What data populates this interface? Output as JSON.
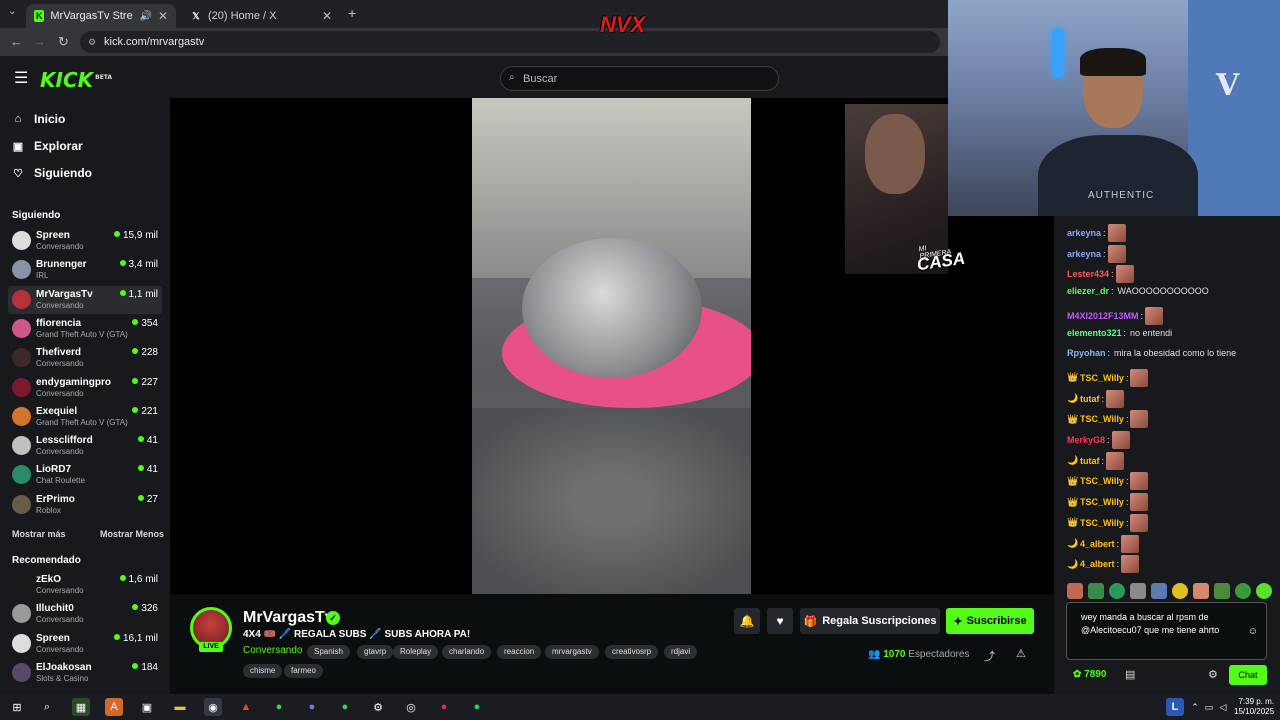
{
  "browser": {
    "tabs": [
      {
        "title": "MrVargasTv Stream - Watch",
        "active": true
      },
      {
        "title": "(20) Home / X",
        "active": false
      }
    ],
    "url": "kick.com/mrvargastv",
    "overlay_logo": "NVX"
  },
  "header": {
    "logo": "KICK",
    "logo_tag": "BETA",
    "search_placeholder": "Buscar"
  },
  "sidebar": {
    "nav": [
      {
        "label": "Inicio",
        "icon": "home-icon"
      },
      {
        "label": "Explorar",
        "icon": "compass-icon"
      },
      {
        "label": "Siguiendo",
        "icon": "heart-icon"
      }
    ],
    "following_title": "Siguiendo",
    "following": [
      {
        "name": "Spreen",
        "category": "Conversando",
        "viewers": "15,9 mil",
        "color": "#ddd"
      },
      {
        "name": "Brunenger",
        "category": "IRL",
        "viewers": "3,4 mil",
        "color": "#8a94a8"
      },
      {
        "name": "MrVargasTv",
        "category": "Conversando",
        "viewers": "1,1 mil",
        "color": "#b5323a",
        "selected": true
      },
      {
        "name": "ffiorencia",
        "category": "Grand Theft Auto V (GTA)",
        "viewers": "354",
        "color": "#d0578a"
      },
      {
        "name": "Thefiverd",
        "category": "Conversando",
        "viewers": "228",
        "color": "#3a2a2a"
      },
      {
        "name": "endygamingpro",
        "category": "Conversando",
        "viewers": "227",
        "color": "#7a1a2a"
      },
      {
        "name": "Exequiel",
        "category": "Grand Theft Auto V (GTA)",
        "viewers": "221",
        "color": "#d0762a"
      },
      {
        "name": "Lessclifford",
        "category": "Conversando",
        "viewers": "41",
        "color": "#c0c0c0"
      },
      {
        "name": "LioRD7",
        "category": "Chat Roulette",
        "viewers": "41",
        "color": "#2a8a6a"
      },
      {
        "name": "ErPrimo",
        "category": "Roblox",
        "viewers": "27",
        "color": "#6a5a4a"
      }
    ],
    "show_more": "Mostrar más",
    "show_less": "Mostrar Menos",
    "recommended_title": "Recomendado",
    "recommended": [
      {
        "name": "zEkO",
        "category": "Conversando",
        "viewers": "1,6 mil",
        "color": "#1a1a1a"
      },
      {
        "name": "Illuchit0",
        "category": "Conversando",
        "viewers": "326",
        "color": "#9a9a9a"
      },
      {
        "name": "Spreen",
        "category": "Conversando",
        "viewers": "16,1 mil",
        "color": "#ddd"
      },
      {
        "name": "ElJoakosan",
        "category": "Slots & Casino",
        "viewers": "184",
        "color": "#5a4a6a"
      }
    ]
  },
  "stream": {
    "overlay_text": "MI PRIMERA",
    "overlay_text2": "CASA",
    "channel": "MrVargasTv",
    "live": "LIVE",
    "title": "4X4 🎟️ 🖊️ REGALA SUBS 🖊️ SUBS AHORA PA!",
    "category": "Conversando",
    "tags": [
      "Spanish",
      "gtavrp",
      "Roleplay",
      "charlando",
      "reaccion",
      "mrvargastv",
      "creativosrp",
      "rdjavi",
      "chisme",
      "farmeo"
    ],
    "gift_label": "Regala Suscripciones",
    "subscribe_label": "Suscribirse",
    "viewers_count": "1070",
    "viewers_label": "Espectadores"
  },
  "chat": {
    "messages": [
      {
        "user": "arkeyna",
        "color": "#8aa8ff",
        "text": "",
        "emote": true,
        "badge": ""
      },
      {
        "user": "arkeyna",
        "color": "#8aa8ff",
        "text": "",
        "emote": true,
        "badge": ""
      },
      {
        "user": "Lester434",
        "color": "#ff5a5a",
        "text": "",
        "emote": true,
        "badge": ""
      },
      {
        "user": "eliezer_dr",
        "color": "#5aff5a",
        "text": "WAOOOOOOOOOOO",
        "emote": false,
        "badge": ""
      },
      {
        "user": "M4XI2012F13MM",
        "color": "#c05aff",
        "text": "",
        "emote": true,
        "badge": ""
      },
      {
        "user": "elemento321",
        "color": "#5aff8a",
        "text": "no entendi",
        "emote": false,
        "badge": ""
      },
      {
        "user": "Rpyohan",
        "color": "#8ab4ff",
        "text": "mira la obesidad como lo tiene",
        "emote": false,
        "badge": ""
      },
      {
        "user": "TSC_Willy",
        "color": "#ffc21a",
        "text": "",
        "emote": true,
        "badge": "👑"
      },
      {
        "user": "tutaf",
        "color": "#ffc21a",
        "text": "",
        "emote": true,
        "badge": "🌙"
      },
      {
        "user": "TSC_Willy",
        "color": "#ffc21a",
        "text": "",
        "emote": true,
        "badge": "👑"
      },
      {
        "user": "MerkyG8",
        "color": "#ff3a5a",
        "text": "",
        "emote": true,
        "badge": ""
      },
      {
        "user": "tutaf",
        "color": "#ffc21a",
        "text": "",
        "emote": true,
        "badge": "🌙"
      },
      {
        "user": "TSC_Willy",
        "color": "#ffc21a",
        "text": "",
        "emote": true,
        "badge": "👑"
      },
      {
        "user": "TSC_Willy",
        "color": "#ffc21a",
        "text": "",
        "emote": true,
        "badge": "👑"
      },
      {
        "user": "TSC_Willy",
        "color": "#ffc21a",
        "text": "",
        "emote": true,
        "badge": "👑"
      },
      {
        "user": "4_albert",
        "color": "#ffc21a",
        "text": "",
        "emote": true,
        "badge": "🌙"
      },
      {
        "user": "4_albert",
        "color": "#ffc21a",
        "text": "",
        "emote": true,
        "badge": "🌙"
      }
    ],
    "input_value": "wey manda a buscar al rpsm de @Alecitoecu07 que me tiene ahrto",
    "points": "7890",
    "send_label": "Chat"
  },
  "taskbar": {
    "time": "7:39 p. m.",
    "date": "15/10/2025",
    "lang": "L"
  },
  "colors": {
    "accent": "#53fc18",
    "bg": "#0b0e0f",
    "panel": "#18191c"
  }
}
